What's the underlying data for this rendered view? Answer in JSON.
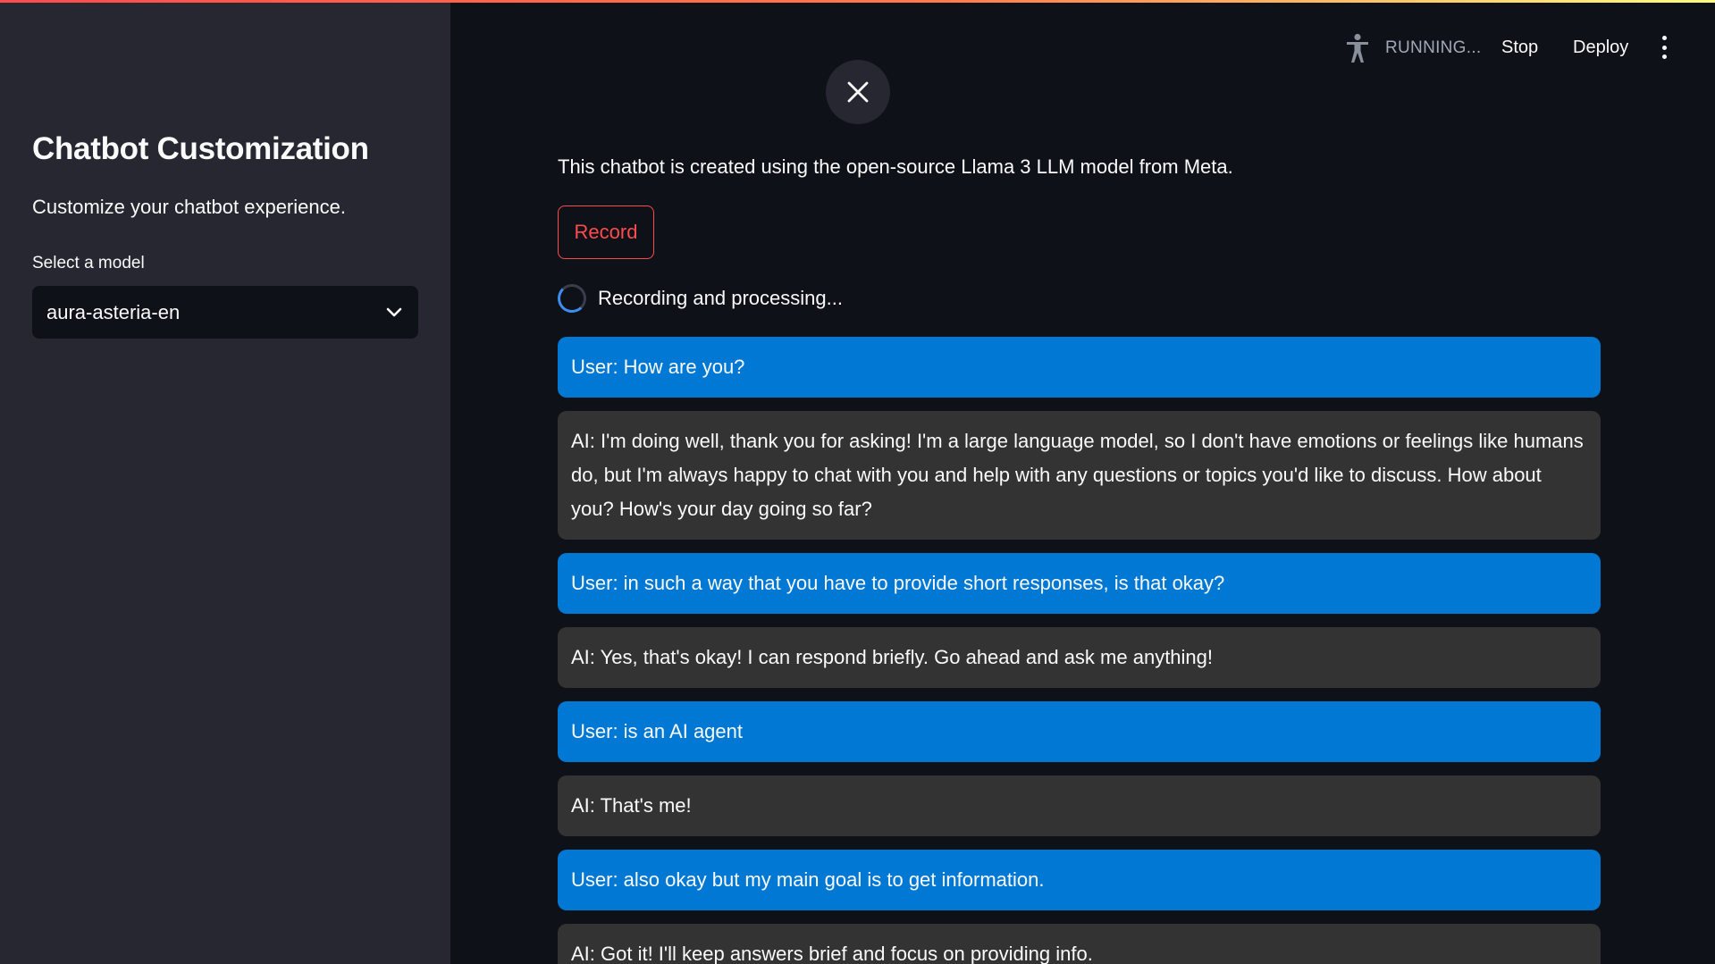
{
  "sidebar": {
    "title": "Chatbot Customization",
    "description": "Customize your chatbot experience.",
    "select_label": "Select a model",
    "select_value": "aura-asteria-en"
  },
  "header": {
    "status": "RUNNING...",
    "stop_label": "Stop",
    "deploy_label": "Deploy"
  },
  "main": {
    "intro": "This chatbot is created using the open-source Llama 3 LLM model from Meta.",
    "record_label": "Record",
    "status_text": "Recording and processing..."
  },
  "messages": [
    {
      "role": "user",
      "text": "User: How are you?"
    },
    {
      "role": "ai",
      "text": "AI: I'm doing well, thank you for asking! I'm a large language model, so I don't have emotions or feelings like humans do, but I'm always happy to chat with you and help with any questions or topics you'd like to discuss. How about you? How's your day going so far?"
    },
    {
      "role": "user",
      "text": "User: in such a way that you have to provide short responses, is that okay?"
    },
    {
      "role": "ai",
      "text": "AI: Yes, that's okay! I can respond briefly. Go ahead and ask me anything!"
    },
    {
      "role": "user",
      "text": "User: is an AI agent"
    },
    {
      "role": "ai",
      "text": "AI: That's me!"
    },
    {
      "role": "user",
      "text": "User: also okay but my main goal is to get information."
    },
    {
      "role": "ai",
      "text": "AI: Got it! I'll keep answers brief and focus on providing info."
    }
  ],
  "colors": {
    "background": "#0e1117",
    "sidebar": "#262730",
    "user_bubble": "#0078d4",
    "ai_bubble": "#333333",
    "accent": "#ff4b4b"
  }
}
